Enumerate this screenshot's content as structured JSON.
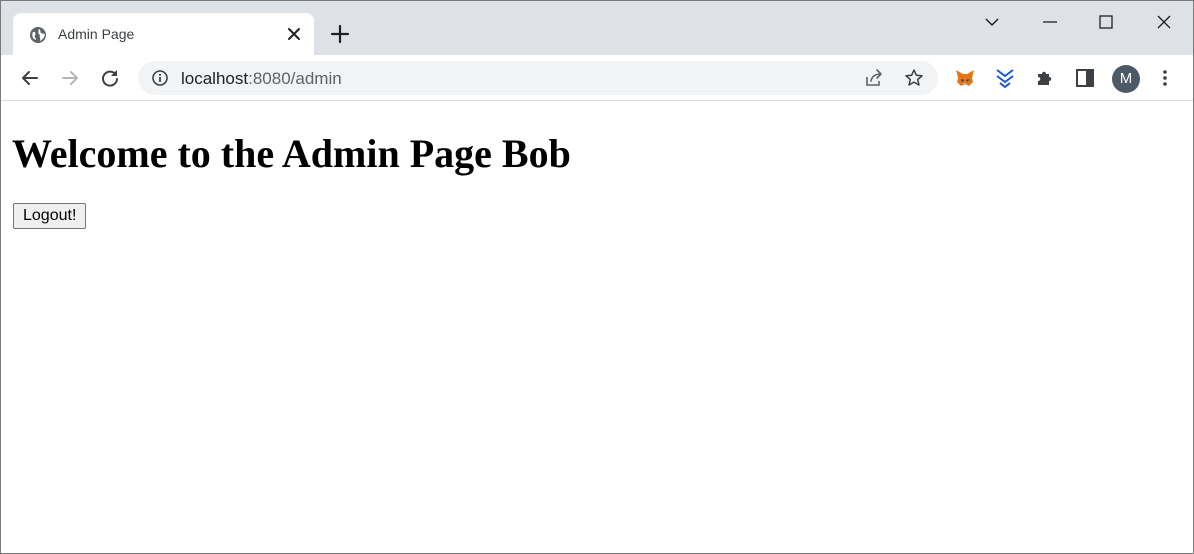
{
  "browser": {
    "tab": {
      "title": "Admin Page"
    },
    "address_bar": {
      "host": "localhost",
      "rest": ":8080/admin"
    },
    "profile": {
      "initial": "M"
    }
  },
  "page": {
    "heading": "Welcome to the Admin Page Bob",
    "logout_label": "Logout!"
  },
  "colors": {
    "tabstrip": "#dee1e6",
    "omnibox": "#f1f3f4",
    "avatar": "#4b5a66"
  }
}
